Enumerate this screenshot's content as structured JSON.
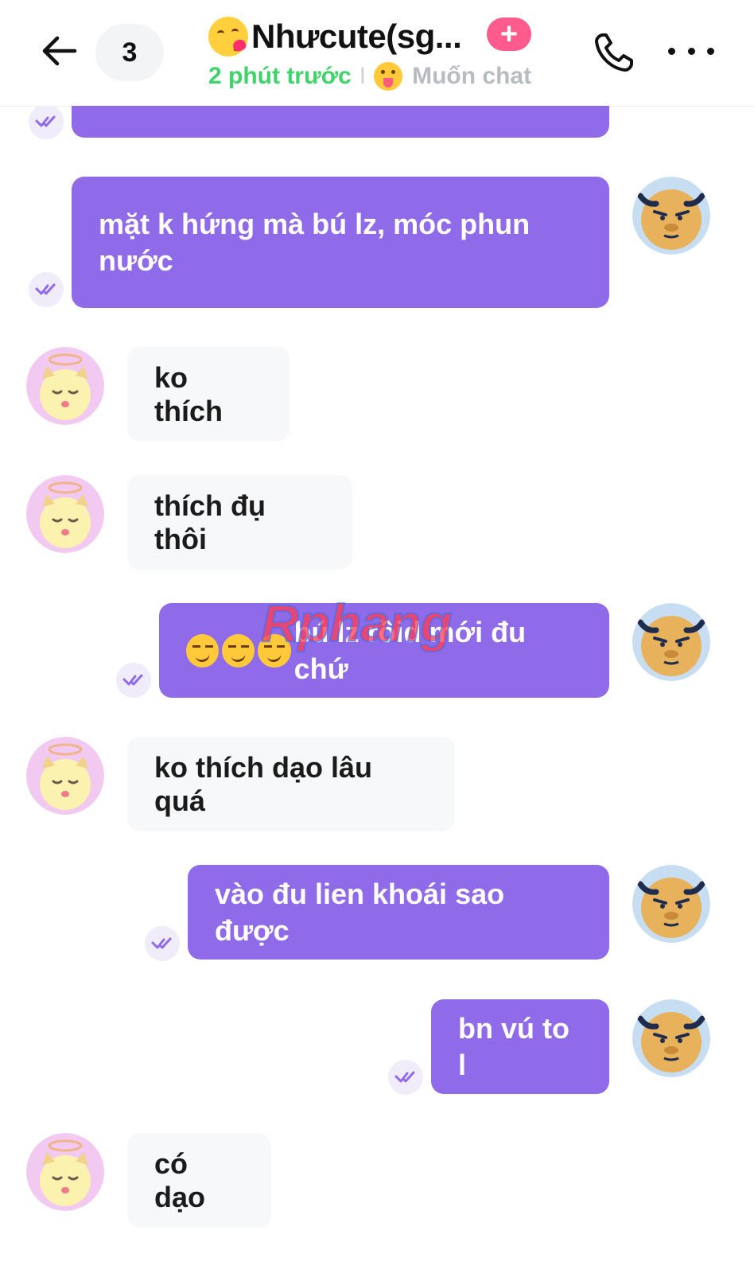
{
  "header": {
    "back_icon": "arrow-left-icon",
    "unread_count": "3",
    "title": "Nhưcute(sg...",
    "title_emoji": "kissing-heart-emoji-icon",
    "add_badge": "+",
    "last_seen": "2 phút trước",
    "separator": "I",
    "status_emoji": "tongue-emoji-icon",
    "status": "Muốn chat",
    "call_icon": "phone-icon",
    "more_icon": "more-dots-icon"
  },
  "colors": {
    "outgoing_bubble": "#8f6ae9",
    "incoming_bubble": "#f7f8f9",
    "online_green": "#3fd36a",
    "badge_pink": "#ff5b8d"
  },
  "messages": [
    {
      "direction": "out",
      "text": "",
      "partial": true
    },
    {
      "direction": "out",
      "text": "mặt k hứng mà bú lz, móc phun nước"
    },
    {
      "direction": "in",
      "text": "ko thích"
    },
    {
      "direction": "in",
      "text": "thích đụ thôi"
    },
    {
      "direction": "out",
      "emoji_prefix": "smirk-emoji-icon x3",
      "text": "bú lz rồid mới đu chứ"
    },
    {
      "direction": "in",
      "text": "ko thích dạo lâu quá"
    },
    {
      "direction": "out",
      "text": "vào đu lien khoái sao được"
    },
    {
      "direction": "out",
      "text": "bn vú to l"
    },
    {
      "direction": "in",
      "text": "có dạo"
    }
  ],
  "watermark": "Rphang"
}
